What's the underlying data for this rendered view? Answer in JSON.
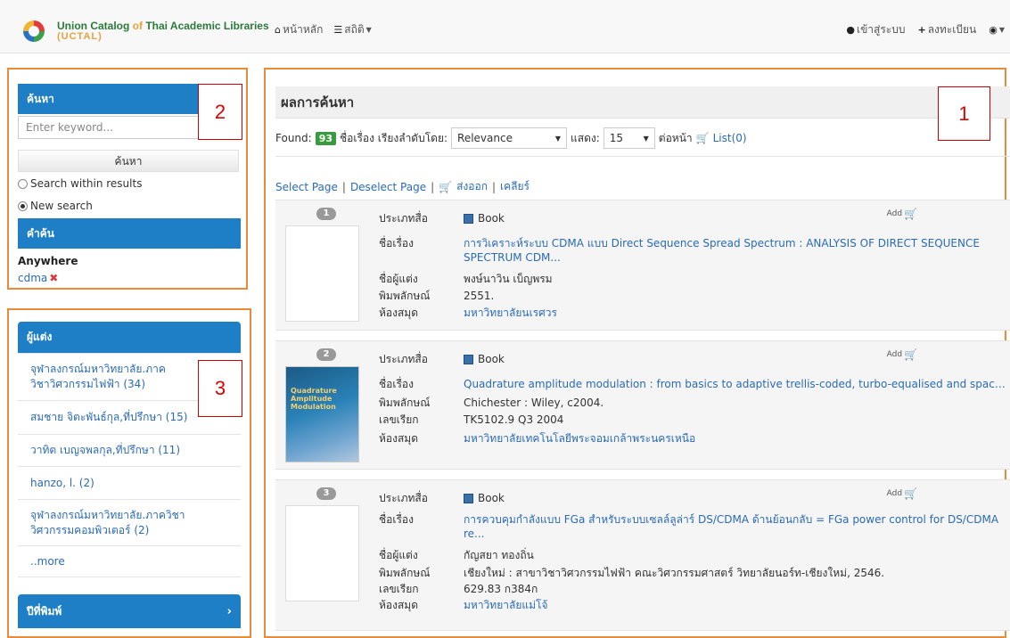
{
  "nav": {
    "logo_title_part1": "Union Catalog",
    "logo_title_of": "of",
    "logo_title_part2": "Thai Academic Libraries",
    "logo_subtitle": "(UCTAL)",
    "home": "หน้าหลัก",
    "stats": "สถิติ",
    "login": "เข้าสู่ระบบ",
    "register": "ลงทะเบียน"
  },
  "search_panel": {
    "header": "ค้นหา",
    "placeholder": "Enter keyword...",
    "button": "ค้นหา",
    "option_within": "Search within results",
    "option_new": "New search",
    "terms_header": "คำค้น",
    "anywhere_label": "Anywhere",
    "term": "cdma"
  },
  "facet_panel": {
    "header": "ผู้แต่ง",
    "items": [
      {
        "label": "จุฬาลงกรณ์มหาวิทยาลัย.ภาควิชาวิศวกรรมไฟฟ้า (34)"
      },
      {
        "label": "สมชาย จิตะพันธ์กุล,ที่ปรึกษา (15)"
      },
      {
        "label": "วาทิต เบญจพลกุล,ที่ปรึกษา (11)"
      },
      {
        "label": "hanzo, l. (2)"
      },
      {
        "label": "จุฬาลงกรณ์มหาวิทยาลัย.ภาควิชาวิศวกรรมคอมพิวเตอร์ (2)"
      },
      {
        "label": "..more"
      }
    ],
    "year_header": "ปีที่พิมพ์"
  },
  "annotations": {
    "box1": "1",
    "box2": "2",
    "box3": "3"
  },
  "results": {
    "header": "ผลการค้นหา",
    "found_label": "Found:",
    "found_count": "93",
    "sort_prefix": "ชื่อเรื่อง เรียงลำดับโดย:",
    "sort_value": "Relevance",
    "show_label": "แสดง:",
    "show_value": "15",
    "per_page": "ต่อหน้า",
    "list_label": "List(0)",
    "actions": {
      "select_page": "Select Page",
      "deselect_page": "Deselect Page",
      "export": "ส่งออก",
      "clear": "เคลียร์"
    },
    "add_label": "Add",
    "cover_title": "Quadrature Amplitude Modulation",
    "items": [
      {
        "num": "1",
        "rows": [
          {
            "label": "ประเภทสื่อ",
            "value": "Book"
          },
          {
            "label": "ชื่อเรื่อง",
            "value": "การวิเคราะห์ระบบ CDMA แบบ Direct Sequence Spread Spectrum : ANALYSIS OF DIRECT SEQUENCE SPECTRUM CDM..."
          },
          {
            "label": "ชื่อผู้แต่ง",
            "value": "พงษ์นาวิน เบ็ญพรม"
          },
          {
            "label": "พิมพลักษณ์",
            "value": "2551."
          },
          {
            "label": "ห้องสมุด",
            "value": "มหาวิทยาลัยนเรศวร"
          }
        ]
      },
      {
        "num": "2",
        "rows": [
          {
            "label": "ประเภทสื่อ",
            "value": "Book"
          },
          {
            "label": "ชื่อเรื่อง",
            "value": "Quadrature amplitude modulation : from basics to adaptive trellis-coded, turbo-equalised and space-..."
          },
          {
            "label": "พิมพลักษณ์",
            "value": "Chichester : Wiley, c2004."
          },
          {
            "label": "เลขเรียก",
            "value": "TK5102.9 Q3 2004"
          },
          {
            "label": "ห้องสมุด",
            "value": "มหาวิทยาลัยเทคโนโลยีพระจอมเกล้าพระนครเหนือ"
          }
        ]
      },
      {
        "num": "3",
        "rows": [
          {
            "label": "ประเภทสื่อ",
            "value": "Book"
          },
          {
            "label": "ชื่อเรื่อง",
            "value": "การควบคุมกำลังแบบ FGa สำหรับระบบเซลล์ลูล่าร์ DS/CDMA ด้านย้อนกลับ = FGa power control for DS/CDMA re..."
          },
          {
            "label": "ชื่อผู้แต่ง",
            "value": "กัญสยา ทองถิ่น"
          },
          {
            "label": "พิมพลักษณ์",
            "value": "เชียงใหม่ : สาขาวิชาวิศวกรรมไฟฟ้า คณะวิศวกรรมศาสตร์ วิทยาลัยนอร์ท-เชียงใหม่, 2546."
          },
          {
            "label": "เลขเรียก",
            "value": "629.83 ก384ก"
          },
          {
            "label": "ห้องสมุด",
            "value": "มหาวิทยาลัยแม่โจ้"
          }
        ]
      }
    ]
  }
}
